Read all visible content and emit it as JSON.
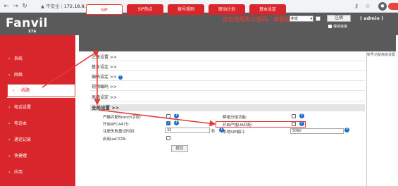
{
  "browser": {
    "address_warning": "不安全",
    "address_separator": "|",
    "url": "172.18.8.17"
  },
  "header": {
    "logo": "Fanvil",
    "model": "X7A",
    "warning": "正在使用默认密码，请更换",
    "language": "中文",
    "logout_label": "注销",
    "admin_label": "( admin )",
    "keep_login_label": "保持连接"
  },
  "sidebar": {
    "items": [
      {
        "label": "系统"
      },
      {
        "label": "网络"
      },
      {
        "label": "线路"
      },
      {
        "label": "电话设置"
      },
      {
        "label": "电话本"
      },
      {
        "label": "通话记录"
      },
      {
        "label": "快捷键"
      },
      {
        "label": "应用"
      }
    ]
  },
  "tabs": [
    {
      "label": "SIP"
    },
    {
      "label": "SIP热点"
    },
    {
      "label": "拨号规则"
    },
    {
      "label": "联动计划"
    },
    {
      "label": "基本设定"
    }
  ],
  "right_hint": "帐号功能高级设置",
  "sections": [
    {
      "label": "注册设置 >>"
    },
    {
      "label": "基本设定 >>"
    },
    {
      "label": "编码设定 >>"
    },
    {
      "label": "视频编码 >>"
    },
    {
      "label": "高级设定 >>"
    }
  ],
  "global_section": {
    "label": "全局设置 >>",
    "fields": {
      "strict_branch": {
        "label": "严格匹配Branch字段:",
        "checked": false
      },
      "enable_rfc4475": {
        "label": "开启RFC4475:",
        "checked": true
      },
      "reg_retry_label": "注册失败重试时间:",
      "reg_retry_value": "32",
      "reg_retry_unit": "秒",
      "enable_uacsta": {
        "label": "启用uaCSTA:",
        "checked": false
      },
      "group_listen": {
        "label": "群组分组功能:",
        "checked": false
      },
      "strict_ua": {
        "label": "开启严格UA匹配:",
        "checked": false
      },
      "local_sip_port_label": "本地SIP端口:",
      "local_sip_port_value": "5060"
    },
    "submit_label": "提交"
  },
  "icons": {
    "back": "back-arrow-icon",
    "forward": "forward-arrow-icon",
    "reload": "reload-icon",
    "help": "help-icon",
    "key": "key-icon",
    "star": "star-icon",
    "profile": "profile-icon"
  },
  "colors": {
    "brand_red": "#d8262c",
    "header_gray": "#5a5a5a",
    "warning_red": "#ff3b30",
    "help_blue": "#1e6ec8"
  }
}
